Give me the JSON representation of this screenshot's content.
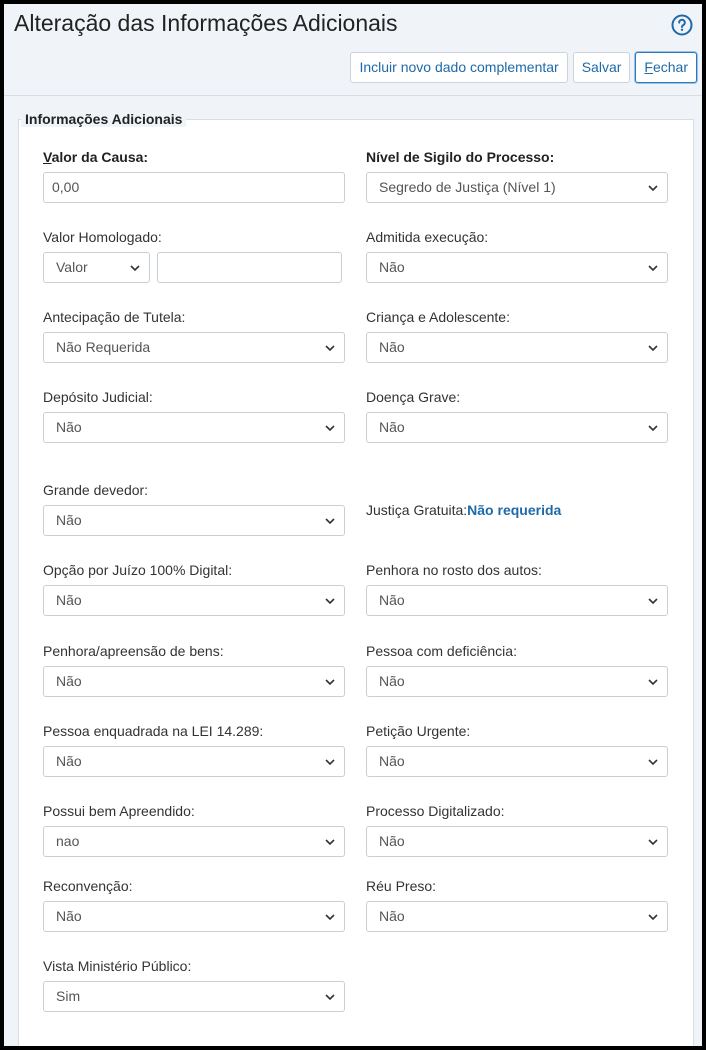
{
  "window": {
    "title": "Alteração das Informações Adicionais",
    "help_icon": "help-circle-icon"
  },
  "toolbar": {
    "include_label": "Incluir novo dado complementar",
    "save_label": "Salvar",
    "close_first_letter": "F",
    "close_rest": "echar"
  },
  "section": {
    "legend": "Informações Adicionais"
  },
  "fields": {
    "valor_causa": {
      "label_first": "V",
      "label_rest": "alor da Causa:",
      "value": "0,00"
    },
    "nivel_sigilo": {
      "label": "Nível de Sigilo do Processo:",
      "value": "Segredo de Justiça (Nível 1)"
    },
    "valor_homologado": {
      "label": "Valor Homologado:",
      "type_value": "Valor",
      "amount": ""
    },
    "admitida_execucao": {
      "label": "Admitida execução:",
      "value": "Não"
    },
    "antecipacao_tutela": {
      "label": "Antecipação de Tutela:",
      "value": "Não Requerida"
    },
    "crianca_adolescente": {
      "label": "Criança e Adolescente:",
      "value": "Não"
    },
    "deposito_judicial": {
      "label": "Depósito Judicial:",
      "value": "Não"
    },
    "doenca_grave": {
      "label": "Doença Grave:",
      "value": "Não"
    },
    "grande_devedor": {
      "label": "Grande devedor:",
      "value": "Não"
    },
    "justica_gratuita": {
      "label": "Justiça Gratuita:",
      "value": "Não requerida"
    },
    "juizo_digital": {
      "label": "Opção por Juízo 100% Digital:",
      "value": "Não"
    },
    "penhora_rosto": {
      "label": "Penhora no rosto dos autos:",
      "value": "Não"
    },
    "penhora_bens": {
      "label": "Penhora/apreensão de bens:",
      "value": "Não"
    },
    "pessoa_deficiencia": {
      "label": "Pessoa com deficiência:",
      "value": "Não"
    },
    "lei_14289": {
      "label": "Pessoa enquadrada na LEI 14.289:",
      "value": "Não"
    },
    "peticao_urgente": {
      "label": "Petição Urgente:",
      "value": "Não"
    },
    "bem_apreendido": {
      "label": "Possui bem Apreendido:",
      "value": "nao"
    },
    "processo_digitalizado": {
      "label": "Processo Digitalizado:",
      "value": "Não"
    },
    "reconvencao": {
      "label": "Reconvenção:",
      "value": "Não"
    },
    "reu_preso": {
      "label": "Réu Preso:",
      "value": "Não"
    },
    "vista_mp": {
      "label": "Vista Ministério Público:",
      "value": "Sim"
    }
  },
  "colors": {
    "accent": "#1e6aa8",
    "border": "#c9cfd5",
    "background": "#f0f4f8"
  }
}
